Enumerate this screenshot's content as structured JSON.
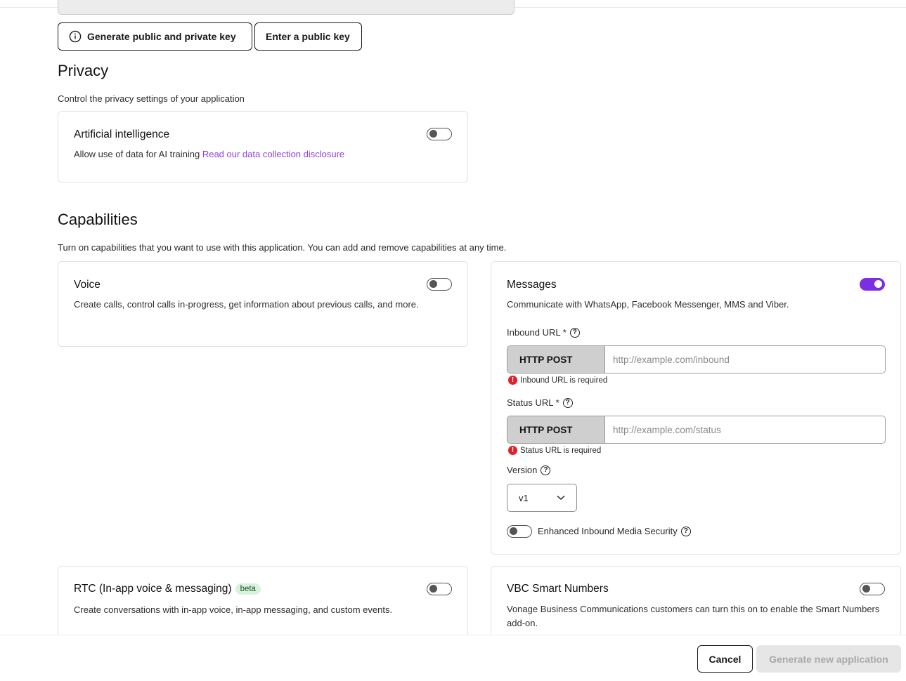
{
  "keys": {
    "generate_label": "Generate public and private key",
    "enter_label": "Enter a public key"
  },
  "privacy": {
    "title": "Privacy",
    "description": "Control the privacy settings of your application",
    "ai": {
      "title": "Artificial intelligence",
      "description": "Allow use of data for AI training ",
      "link": "Read our data collection disclosure",
      "enabled": false
    }
  },
  "capabilities": {
    "title": "Capabilities",
    "description": "Turn on capabilities that you want to use with this application. You can add and remove capabilities at any time.",
    "voice": {
      "title": "Voice",
      "description": "Create calls, control calls in-progress, get information about previous calls, and more.",
      "enabled": false
    },
    "messages": {
      "title": "Messages",
      "description": "Communicate with WhatsApp, Facebook Messenger, MMS and Viber.",
      "enabled": true,
      "inbound_label": "Inbound URL *",
      "inbound_method": "HTTP POST",
      "inbound_placeholder": "http://example.com/inbound",
      "inbound_error": "Inbound URL is required",
      "status_label": "Status URL *",
      "status_method": "HTTP POST",
      "status_placeholder": "http://example.com/status",
      "status_error": "Status URL is required",
      "version_label": "Version",
      "version_value": "v1",
      "media_security_label": "Enhanced Inbound Media Security",
      "media_security_enabled": false
    },
    "rtc": {
      "title": "RTC (In-app voice & messaging)",
      "badge": "beta",
      "description": "Create conversations with in-app voice, in-app messaging, and custom events.",
      "enabled": false
    },
    "vbc": {
      "title": "VBC Smart Numbers",
      "description": "Vonage Business Communications customers can turn this on to enable the Smart Numbers add-on.",
      "enabled": false
    }
  },
  "footer": {
    "cancel_label": "Cancel",
    "generate_label": "Generate new application"
  },
  "colors": {
    "accent": "#7b2fe0",
    "link": "#8e3fe0",
    "error": "#e0202a",
    "badge_bg": "#d8f3dc"
  }
}
